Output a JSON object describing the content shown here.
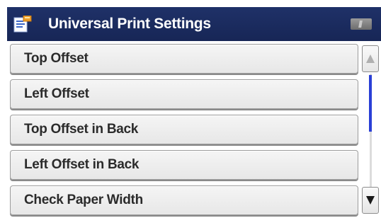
{
  "header": {
    "title": "Universal Print Settings",
    "icon": "settings-document-icon",
    "status_icon": "pc-connection-icon"
  },
  "menu": {
    "items": [
      {
        "label": "Top Offset"
      },
      {
        "label": "Left Offset"
      },
      {
        "label": "Top Offset in Back"
      },
      {
        "label": "Left Offset in Back"
      },
      {
        "label": "Check Paper Width"
      }
    ]
  },
  "scrollbar": {
    "up_icon": "arrow-up-icon",
    "down_icon": "arrow-down-icon",
    "thumb_color": "#2a3fd6"
  },
  "colors": {
    "header_bg": "#1f3168",
    "button_bg": "#eeeeee"
  }
}
